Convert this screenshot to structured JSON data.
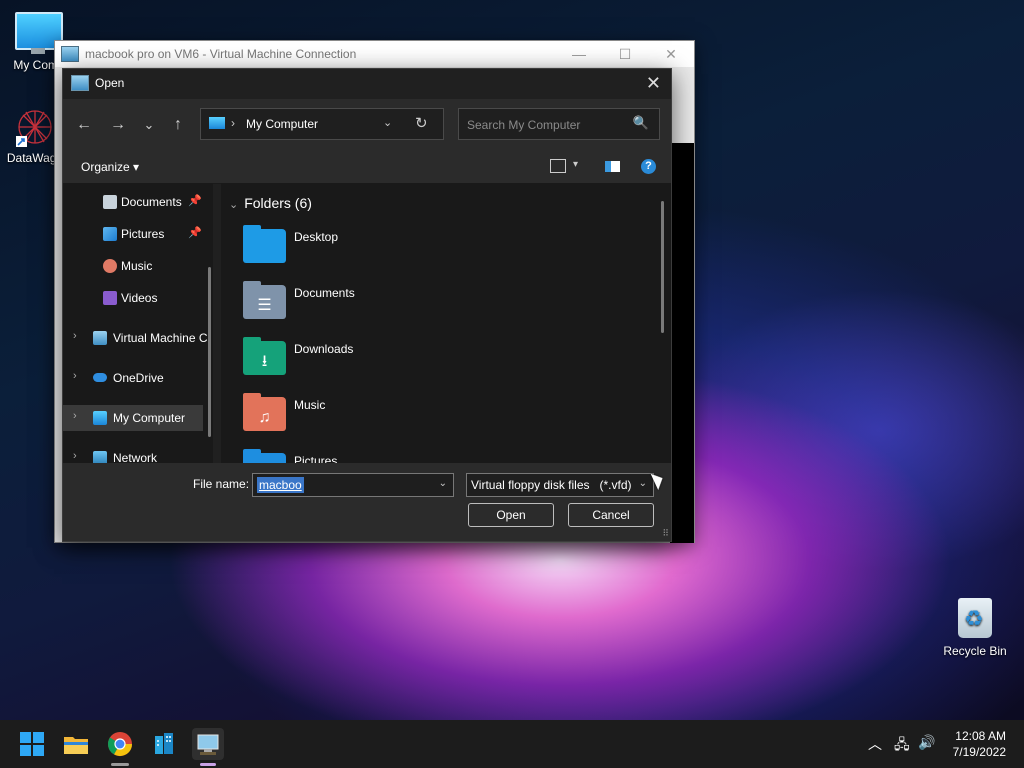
{
  "desktop": {
    "icons": [
      {
        "label": "My Comp",
        "icon": "monitor-icon"
      },
      {
        "label": "DataWago",
        "icon": "datawagon-shortcut-icon"
      },
      {
        "label": "Recycle Bin",
        "icon": "recycle-bin-icon"
      }
    ]
  },
  "vm_window": {
    "title": "macbook pro on VM6 - Virtual Machine Connection",
    "controls": {
      "minimize": "—",
      "maximize": "☐",
      "close": "✕"
    }
  },
  "dialog": {
    "title": "Open",
    "close": "✕",
    "nav": {
      "back": "←",
      "forward": "→",
      "recent": "⌄",
      "up": "↑"
    },
    "address": {
      "separator": "›",
      "location": "My Computer",
      "dropdown": "⌄",
      "refresh": "↻"
    },
    "search": {
      "placeholder": "Search My Computer",
      "icon": "🔍"
    },
    "toolbar": {
      "organize": "Organize ▾",
      "view_dropdown": "▾",
      "help": "?"
    },
    "nav_pane": [
      {
        "label": "Documents",
        "icon": "documents-icon",
        "pinned": "📌"
      },
      {
        "label": "Pictures",
        "icon": "pictures-icon",
        "pinned": "📌"
      },
      {
        "label": "Music",
        "icon": "music-icon"
      },
      {
        "label": "Videos",
        "icon": "videos-icon"
      },
      {
        "label": "Virtual Machine C",
        "icon": "virtual-machine-icon",
        "expand": "›"
      },
      {
        "label": "OneDrive",
        "icon": "onedrive-icon",
        "expand": "›"
      },
      {
        "label": "My Computer",
        "icon": "computer-icon",
        "expand": "›",
        "selected": true
      },
      {
        "label": "Network",
        "icon": "network-icon",
        "expand": "›"
      }
    ],
    "content": {
      "group_chevron": "⌄",
      "group_header": "Folders (6)",
      "folders": [
        {
          "name": "Desktop",
          "icon": "desktop-folder-icon",
          "glyph": "",
          "color": "#1e9be6"
        },
        {
          "name": "Documents",
          "icon": "documents-folder-icon",
          "glyph": "☰",
          "color": "#7f93aa"
        },
        {
          "name": "Downloads",
          "icon": "downloads-folder-icon",
          "glyph": "⭳",
          "color": "#15a27a"
        },
        {
          "name": "Music",
          "icon": "music-folder-icon",
          "glyph": "♫",
          "color": "#e2735a"
        },
        {
          "name": "Pictures",
          "icon": "pictures-folder-icon",
          "glyph": "",
          "color": "#1e8ee0"
        }
      ]
    },
    "bottom": {
      "filename_label": "File name:",
      "filename_value": "macboo",
      "filename_dropdown": "⌄",
      "filetype_value": "Virtual floppy disk files   (*.vfd)",
      "filetype_dropdown": "⌄",
      "open_button": "Open",
      "cancel_button": "Cancel",
      "resize_grip": "⠿"
    }
  },
  "taskbar": {
    "apps": [
      {
        "name": "start",
        "icon": "windows-start-icon"
      },
      {
        "name": "file-explorer",
        "icon": "file-explorer-icon"
      },
      {
        "name": "chrome",
        "icon": "chrome-icon"
      },
      {
        "name": "office-building",
        "icon": "server-app-icon"
      },
      {
        "name": "vm-connection",
        "icon": "vm-connection-icon"
      }
    ],
    "tray": {
      "chevron": "︿",
      "network": "🖧",
      "volume": "🔊"
    },
    "clock": {
      "time": "12:08 AM",
      "date": "7/19/2022"
    }
  },
  "colors": {
    "dialog_bg": "#202020",
    "accent": "#3a76c8",
    "taskbar": "#1c1c1c"
  }
}
